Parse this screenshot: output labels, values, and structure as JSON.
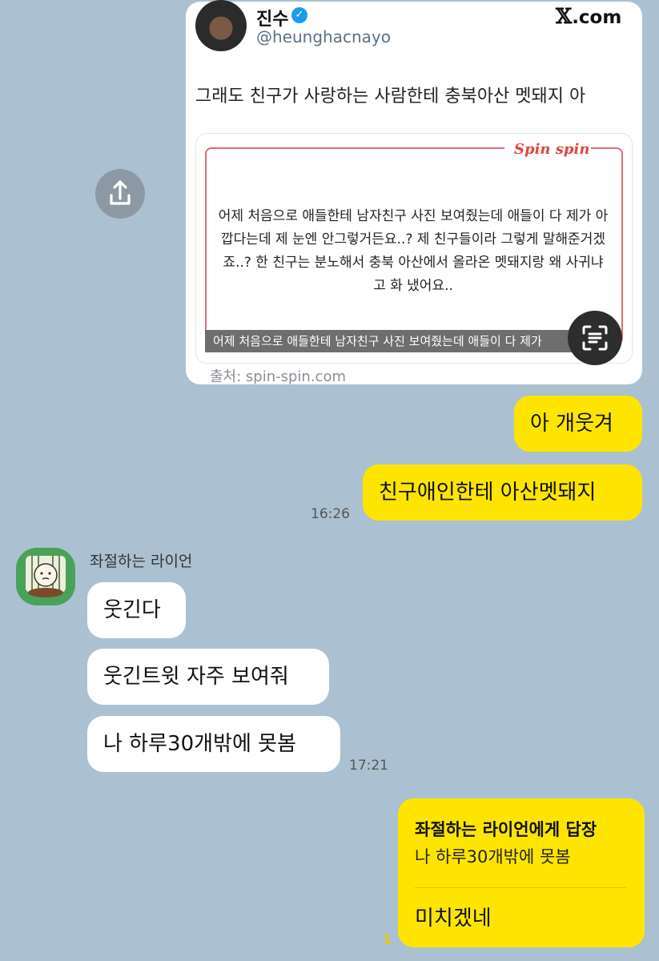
{
  "shared_tweet": {
    "name": "진수",
    "handle": "@heunghacnayo",
    "site": ".com",
    "site_mark": "𝕏",
    "text": "그래도 친구가 사랑하는 사람한테 충북아산 멧돼지 아",
    "preview": {
      "brand": "Spin spin",
      "body": "어제 처음으로 애들한테 남자친구 사진 보여줬는데 애들이 다 제가 아깝다는데 제 눈엔 안그렇거든요..? 제 친구들이라 그렇게 말해준거겠죠..? 한 친구는 분노해서 충북 아산에서 올라온 멧돼지랑 왜 사귀냐고 화 냈어요..",
      "caption": "어제 처음으로 애들한테 남자친구 사진 보여줬는데 애들이 다 제가"
    },
    "source": "출처: spin-spin.com"
  },
  "messages": [
    {
      "text": "아 개웃겨"
    },
    {
      "text": "친구애인한테 아산멧돼지"
    },
    {
      "text": "웃긴다"
    },
    {
      "text": "웃긴트윗 자주 보여줘"
    },
    {
      "text": "나 하루30개밖에 못봄"
    }
  ],
  "times": {
    "t1": "16:26",
    "t2": "17:21"
  },
  "sender": {
    "name": "좌절하는 라이언"
  },
  "reply": {
    "title": "좌절하는 라이언에게 답장",
    "quote": "나 하루30개밖에 못봄",
    "text": "미치겠네",
    "unread": "1"
  },
  "colors": {
    "background": "#abc1d1",
    "my_bubble": "#fee500",
    "other_bubble": "#ffffff"
  }
}
